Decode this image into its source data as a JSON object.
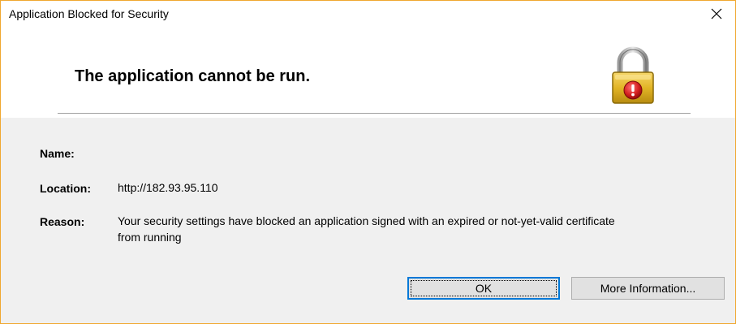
{
  "window": {
    "title": "Application Blocked for Security",
    "close_label": "✕"
  },
  "header": {
    "headline": "The application cannot be run."
  },
  "details": {
    "name_label": "Name:",
    "name_value": "",
    "location_label": "Location:",
    "location_value": "http://182.93.95.110",
    "reason_label": "Reason:",
    "reason_line1": "Your security settings have blocked an application signed with an expired or not-yet-valid certificate",
    "reason_line2": "from running"
  },
  "buttons": {
    "ok_label": "OK",
    "more_info_label": "More Information..."
  },
  "icons": {
    "close": "close-icon",
    "lock": "padlock-warning-icon"
  },
  "colors": {
    "window_border": "#f0a830",
    "default_button_border": "#0078d7",
    "lock_gold": "#e8b820",
    "warning_red": "#d42020"
  }
}
